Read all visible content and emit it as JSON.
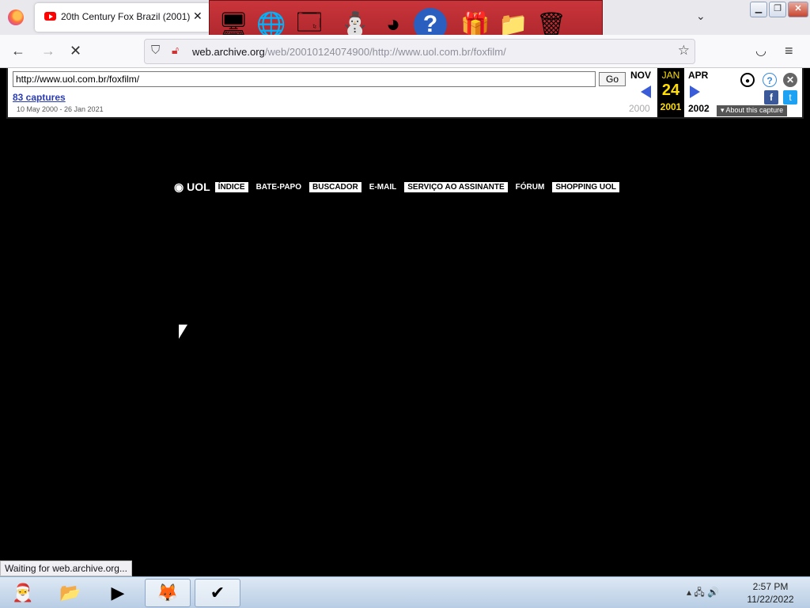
{
  "browser": {
    "tab_title": "20th Century Fox Brazil (2001) -",
    "tab_close": "✕",
    "url_host": "web.archive.org",
    "url_path": "/web/20010124074900/http://www.uol.com.br/foxfilm/",
    "status": "Waiting for web.archive.org..."
  },
  "dock": {
    "icons": [
      "santa-computer-icon",
      "globe-monitor-icon",
      "control-panel-icon",
      "snowman-icon",
      "windows-logo-icon",
      "help-icon",
      "gift-icon",
      "folder-icon",
      "recycle-bin-icon"
    ]
  },
  "wayback": {
    "url_value": "http://www.uol.com.br/foxfilm/",
    "go_label": "Go",
    "captures": "83 captures",
    "range": "10 May 2000 - 26 Jan 2021",
    "prev_month": "NOV",
    "cur_month": "JAN",
    "next_month": "APR",
    "cur_day": "24",
    "prev_year": "2000",
    "cur_year": "2001",
    "next_year": "2002",
    "about": "About this capture"
  },
  "uol": {
    "logo": "UOL",
    "nav": [
      "ÍNDICE",
      "BATE-PAPO",
      "BUSCADOR",
      "E-MAIL",
      "SERVIÇO AO ASSINANTE",
      "FÓRUM",
      "SHOPPING UOL"
    ]
  },
  "taskbar": {
    "time": "2:57 PM",
    "date": "11/22/2022"
  },
  "colors": {
    "page_bg": "#000000",
    "wayback_accent": "#ffde00",
    "dock_bg": "#c9353a"
  }
}
